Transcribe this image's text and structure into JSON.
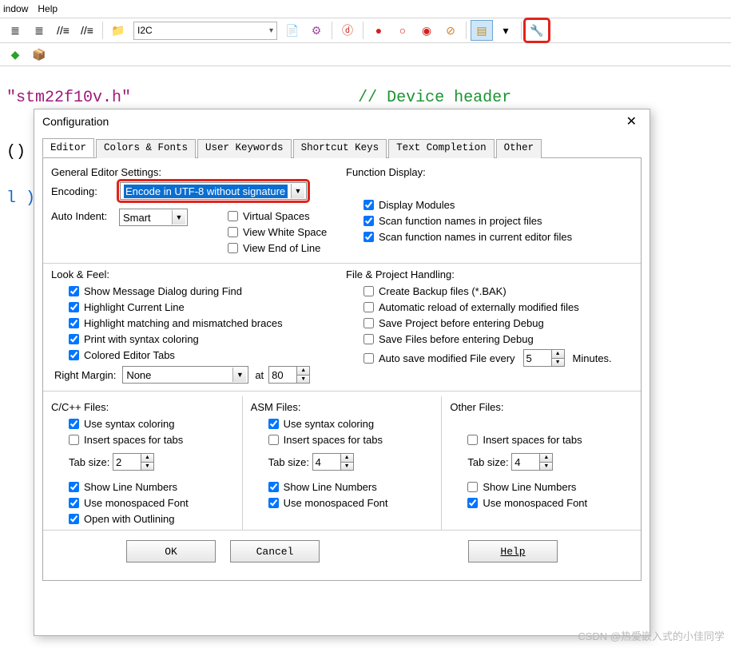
{
  "menu": {
    "window": "indow",
    "help": "Help"
  },
  "toolbar": {
    "combo_value": "I2C"
  },
  "code": {
    "line1_str": "\"stm22f10v.h\"",
    "line1_cmt": "// Device header",
    "line2": "()",
    "line3": "l )"
  },
  "dialog": {
    "title": "Configuration",
    "tabs": [
      "Editor",
      "Colors & Fonts",
      "User Keywords",
      "Shortcut Keys",
      "Text Completion",
      "Other"
    ],
    "general_heading": "General Editor Settings:",
    "encoding_label": "Encoding:",
    "encoding_value": "Encode in UTF-8 without signature",
    "auto_indent_label": "Auto Indent:",
    "auto_indent_value": "Smart",
    "virtual_spaces": "Virtual Spaces",
    "view_white": "View White Space",
    "view_eol": "View End of Line",
    "look_feel": "Look & Feel:",
    "lf": {
      "msg": "Show Message Dialog during Find",
      "hl_line": "Highlight Current Line",
      "hl_braces": "Highlight matching and mismatched braces",
      "print_syntax": "Print with syntax coloring",
      "color_tabs": "Colored Editor Tabs",
      "right_margin": "Right Margin:",
      "right_margin_val": "None",
      "at": "at",
      "at_val": "80"
    },
    "func_display": "Function Display:",
    "fd": {
      "modules": "Display Modules",
      "scan_proj": "Scan function names in project files",
      "scan_editor": "Scan function names in current editor files"
    },
    "file_handling": "File & Project Handling:",
    "fh": {
      "backup": "Create Backup files (*.BAK)",
      "reload": "Automatic reload of externally modified files",
      "save_proj": "Save Project before entering Debug",
      "save_files": "Save Files before entering Debug",
      "autosave": "Auto save modified File every",
      "autosave_val": "5",
      "minutes": "Minutes."
    },
    "c_files": "C/C++ Files:",
    "asm_files": "ASM Files:",
    "other_files": "Other Files:",
    "common": {
      "syntax": "Use syntax coloring",
      "insert_spaces": "Insert spaces for tabs",
      "tab_size": "Tab size:",
      "show_line": "Show Line Numbers",
      "mono": "Use monospaced Font",
      "outline": "Open with Outlining"
    },
    "tabsize_c": "2",
    "tabsize_asm": "4",
    "tabsize_other": "4",
    "buttons": {
      "ok": "OK",
      "cancel": "Cancel",
      "help": "Help"
    }
  },
  "watermark": "CSDN @热爱嵌入式的小佳同学"
}
